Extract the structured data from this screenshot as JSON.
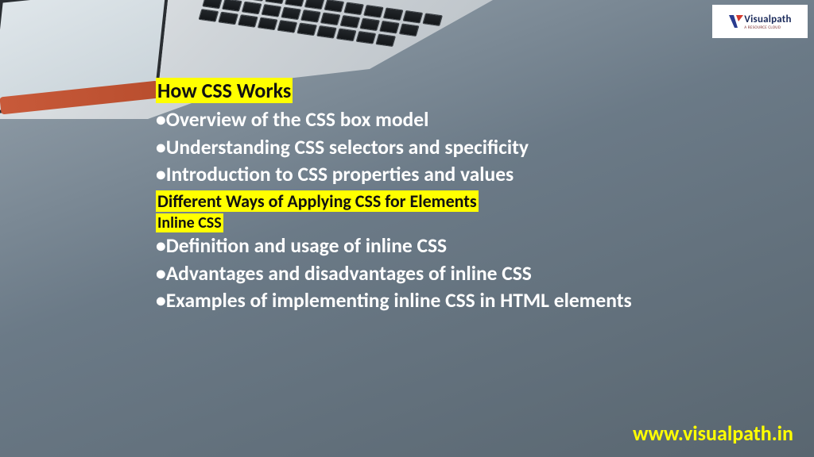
{
  "logo": {
    "brand": "Visualpath",
    "tagline": "A RESOURCE CLOUD"
  },
  "section1": {
    "heading": "How CSS Works",
    "bullets": [
      "Overview of the CSS box model",
      "Understanding CSS selectors and specificity",
      "Introduction to CSS properties and values"
    ]
  },
  "section2": {
    "heading": "Different Ways of Applying CSS for Elements",
    "subheading": "Inline CSS",
    "bullets": [
      "Definition and usage of inline CSS",
      "Advantages and disadvantages of inline CSS",
      "Examples of implementing inline CSS in HTML elements"
    ]
  },
  "footer": {
    "url": "www.visualpath.in"
  },
  "colors": {
    "highlight": "#ffff00",
    "bodyText": "#ffffff"
  }
}
